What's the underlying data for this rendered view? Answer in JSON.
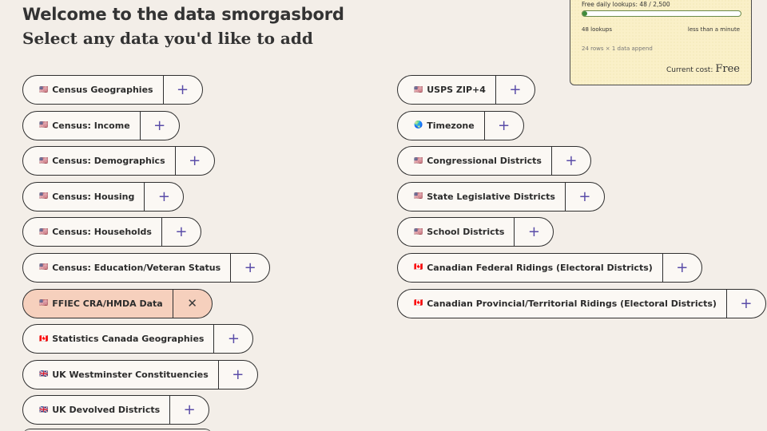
{
  "header": {
    "title": "Welcome to the data smorgasbord",
    "subtitle": "Select any data you'd like to add"
  },
  "cost_panel": {
    "lookups_label": "Free daily lookups: 48 / 2,500",
    "lookups_fraction": 0.0192,
    "lookups_count": "48 lookups",
    "time_estimate": "less than a minute",
    "rows_info": "24 rows × 1 data append",
    "cost_label": "Current cost:",
    "cost_value": "Free",
    "bar_color": "#3f8a3a"
  },
  "left_column": [
    {
      "flag": "🇺🇸",
      "label": "Census Geographies",
      "action": "+",
      "selected": false
    },
    {
      "flag": "🇺🇸",
      "label": "Census: Income",
      "action": "+",
      "selected": false
    },
    {
      "flag": "🇺🇸",
      "label": "Census: Demographics",
      "action": "+",
      "selected": false
    },
    {
      "flag": "🇺🇸",
      "label": "Census: Housing",
      "action": "+",
      "selected": false
    },
    {
      "flag": "🇺🇸",
      "label": "Census: Households",
      "action": "+",
      "selected": false
    },
    {
      "flag": "🇺🇸",
      "label": "Census: Education/Veteran Status",
      "action": "+",
      "selected": false
    },
    {
      "flag": "🇺🇸",
      "label": "FFIEC CRA/HMDA Data",
      "action": "✕",
      "selected": true
    },
    {
      "flag": "🇨🇦",
      "label": "Statistics Canada Geographies",
      "action": "+",
      "selected": false
    },
    {
      "flag": "🇬🇧",
      "label": "UK Westminster Constituencies",
      "action": "+",
      "selected": false
    },
    {
      "flag": "🇬🇧",
      "label": "UK Devolved Districts",
      "action": "+",
      "selected": false
    }
  ],
  "right_column": [
    {
      "flag": "🇺🇸",
      "label": "USPS ZIP+4",
      "action": "+",
      "selected": false
    },
    {
      "flag": "🌏",
      "label": "Timezone",
      "action": "+",
      "selected": false
    },
    {
      "flag": "🇺🇸",
      "label": "Congressional Districts",
      "action": "+",
      "selected": false
    },
    {
      "flag": "🇺🇸",
      "label": "State Legislative Districts",
      "action": "+",
      "selected": false
    },
    {
      "flag": "🇺🇸",
      "label": "School Districts",
      "action": "+",
      "selected": false
    },
    {
      "flag": "🇨🇦",
      "label": "Canadian Federal Ridings (Electoral Districts)",
      "action": "+",
      "selected": false
    },
    {
      "flag": "🇨🇦",
      "label": "Canadian Provincial/Territorial Ridings (Electoral Districts)",
      "action": "+",
      "selected": false
    }
  ],
  "colors": {
    "background": "#f3eee8",
    "accent_plus": "#5a4ca8",
    "selected_fill": "#f6d0bd",
    "panel_fill": "#faf0c8"
  }
}
